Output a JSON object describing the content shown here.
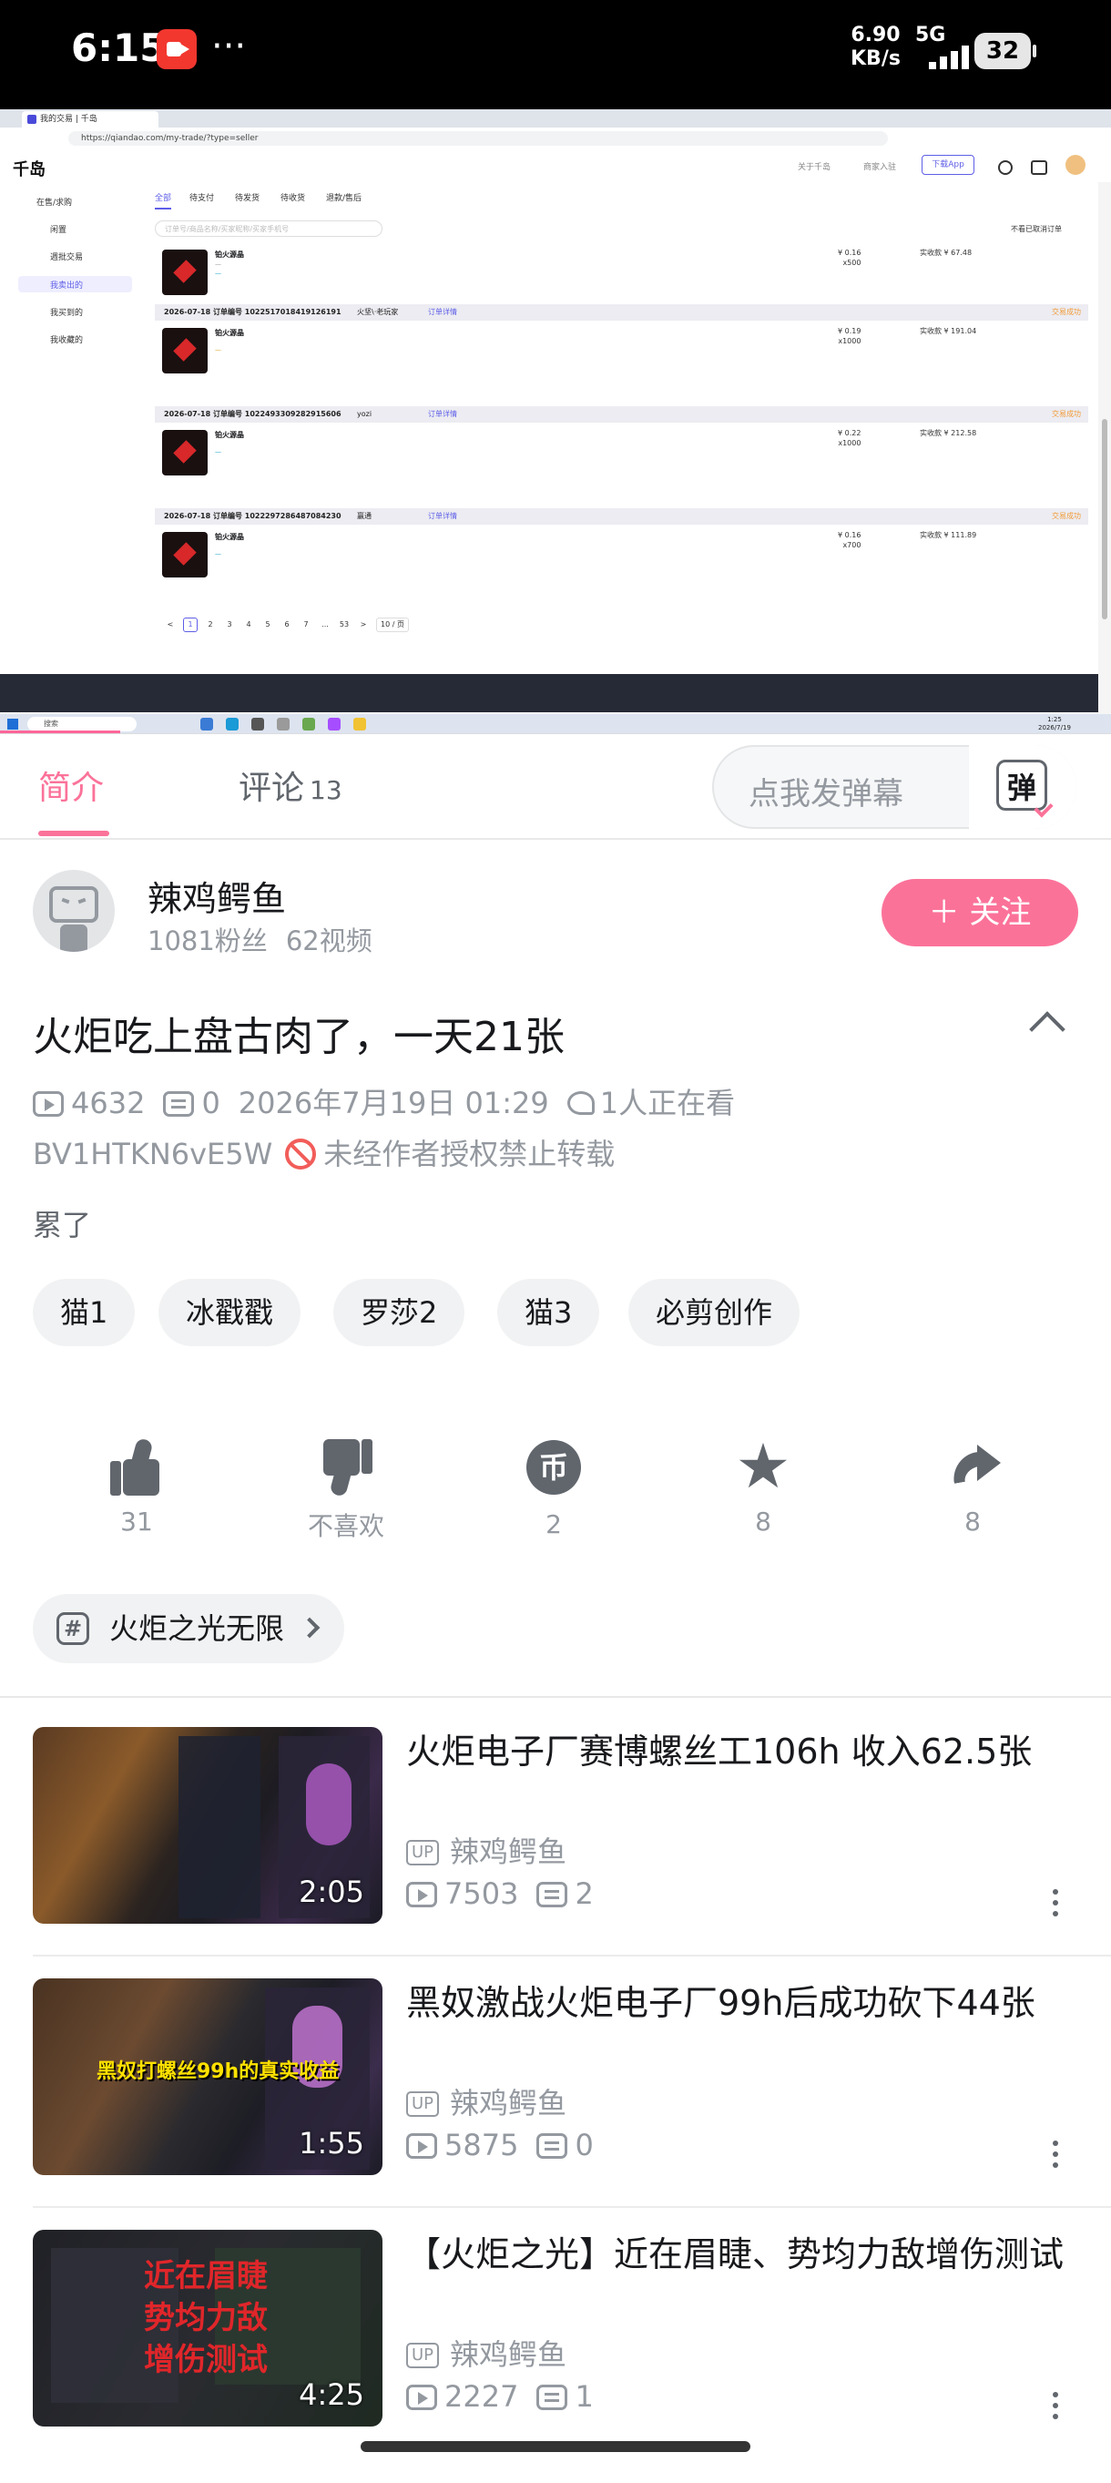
{
  "status_bar": {
    "time": "6:15",
    "speed_value": "6.90",
    "speed_unit": "KB/s",
    "network": "5G",
    "battery": "32"
  },
  "screenshot": {
    "browser_tab_title": "我的交易 | 千岛",
    "url": "https://qiandao.com/my-trade/?type=seller",
    "site_logo": "千岛",
    "header_links": [
      "关于千岛",
      "商家入驻"
    ],
    "download_button": "下载App",
    "sidebar": [
      "在售/求购",
      "闲置",
      "週批交易",
      "我卖出的",
      "我买到的",
      "我收藏的"
    ],
    "order_tabs": [
      "全部",
      "待支付",
      "待发货",
      "待收货",
      "退款/售后"
    ],
    "search_placeholder": "订单号/商品名称/买家昵称/买家手机号",
    "hide_cancelled": "不看已取消订单",
    "orders": [
      {
        "date": "",
        "order_no": "",
        "buyer": "",
        "link": "",
        "status": "",
        "product": "铂火源晶",
        "qty": "x500",
        "price": "¥ 0.16",
        "paid_label": "实收款",
        "paid": "¥ 67.48"
      },
      {
        "date": "2026-07-18",
        "order_no": "订单编号 1022517018419126191",
        "buyer": "火坚\\·老玩家",
        "link": "订单详情",
        "status": "交易成功",
        "product": "铂火源晶",
        "qty": "x1000",
        "price": "¥ 0.19",
        "paid_label": "实收款",
        "paid": "¥ 191.04"
      },
      {
        "date": "2026-07-18",
        "order_no": "订单编号 1022493309282915606",
        "buyer": "yozi",
        "link": "订单详情",
        "status": "交易成功",
        "product": "铂火源晶",
        "qty": "x1000",
        "price": "¥ 0.22",
        "paid_label": "实收款",
        "paid": "¥ 212.58"
      },
      {
        "date": "2026-07-18",
        "order_no": "订单编号 1022297286487084230",
        "buyer": "赢通",
        "link": "订单详情",
        "status": "交易成功",
        "product": "铂火源晶",
        "qty": "x700",
        "price": "¥ 0.16",
        "paid_label": "实收款",
        "paid": "¥ 111.89"
      }
    ],
    "pager": [
      "<",
      "1",
      "2",
      "3",
      "4",
      "5",
      "6",
      "7",
      "...",
      "53",
      ">",
      "10 / 页"
    ],
    "taskbar_search": "搜索",
    "clock_time": "1:25",
    "clock_date": "2026/7/19"
  },
  "tabs": {
    "intro": "简介",
    "comments": "评论",
    "comments_count": "13",
    "danmaku_placeholder": "点我发弹幕",
    "danmaku_button": "弹"
  },
  "uploader": {
    "name": "辣鸡鳄鱼",
    "fans": "1081粉丝",
    "videos": "62视频",
    "follow": "＋ 关注"
  },
  "video": {
    "title": "火炬吃上盘古肉了，一天21张",
    "views": "4632",
    "danmaku_count": "0",
    "date": "2026年7月19日 01:29",
    "watching": "1人正在看",
    "bvid": "BV1HTKN6vE5W",
    "copyright": "未经作者授权禁止转载",
    "description": "累了",
    "tags": [
      "猫1",
      "冰戳戳",
      "罗莎2",
      "猫3",
      "必剪创作"
    ]
  },
  "actions": {
    "like": "31",
    "dislike": "不喜欢",
    "coin": "2",
    "favorite": "8",
    "share": "8",
    "coin_glyph": "币"
  },
  "topic": {
    "icon": "#",
    "label": "火炬之光无限"
  },
  "recommendations": [
    {
      "title": "火炬电子厂赛博螺丝工106h 收入62.5张",
      "up": "辣鸡鳄鱼",
      "views": "7503",
      "danmaku": "2",
      "duration": "2:05",
      "overlay": ""
    },
    {
      "title": "黑奴激战火炬电子厂99h后成功砍下44张",
      "up": "辣鸡鳄鱼",
      "views": "5875",
      "danmaku": "0",
      "duration": "1:55",
      "overlay": "黑奴打螺丝99h的真实收益"
    },
    {
      "title": "【火炬之光】近在眉睫、势均力敌增伤测试",
      "up": "辣鸡鳄鱼",
      "views": "2227",
      "danmaku": "1",
      "duration": "4:25",
      "overlay": "近在眉睫 势均力敌 增伤测试"
    }
  ],
  "up_badge": "UP"
}
